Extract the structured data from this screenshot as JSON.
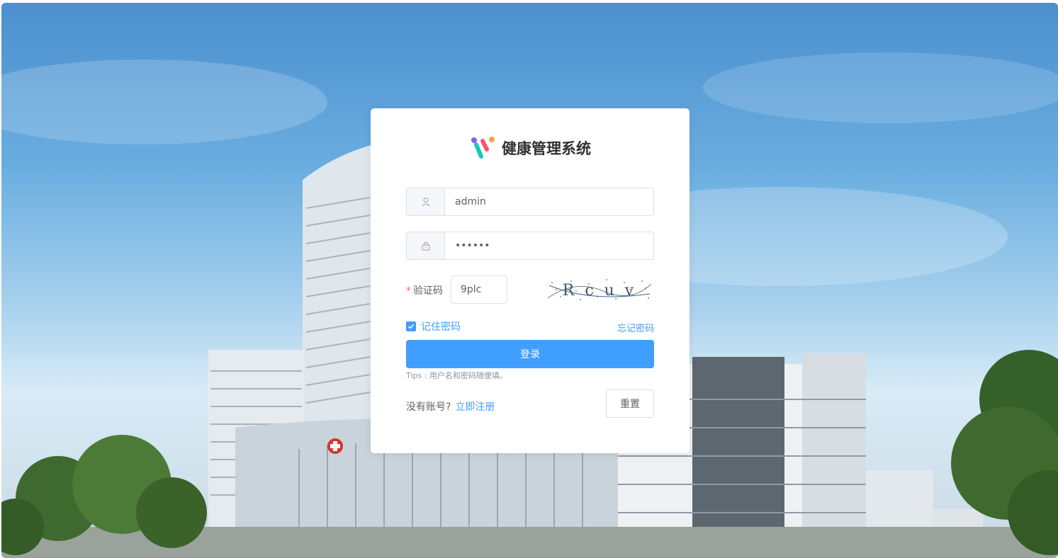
{
  "app": {
    "title": "健康管理系统"
  },
  "login": {
    "username_value": "admin",
    "password_value": "admin1",
    "captcha_label": "验证码",
    "captcha_required_mark": "*",
    "captcha_value": "9plc",
    "captcha_image_text": "R c u v",
    "remember_label": "记住密码",
    "remember_checked": true,
    "forgot_label": "忘记密码",
    "login_label": "登录",
    "tips": "Tips : 用户名和密码随便填。",
    "no_account_text": "没有账号?",
    "register_link": "立即注册",
    "reset_label": "重置"
  },
  "icons": {
    "username_prefix": "user-icon",
    "password_prefix": "lock-icon",
    "checkbox": "check-icon",
    "logo": "app-logo"
  },
  "colors": {
    "primary": "#409eff",
    "required": "#f56c6c",
    "logo_purple": "#8a5cf6",
    "logo_teal": "#1bc5bd",
    "logo_red": "#f5576c",
    "logo_orange": "#f9a14b"
  }
}
